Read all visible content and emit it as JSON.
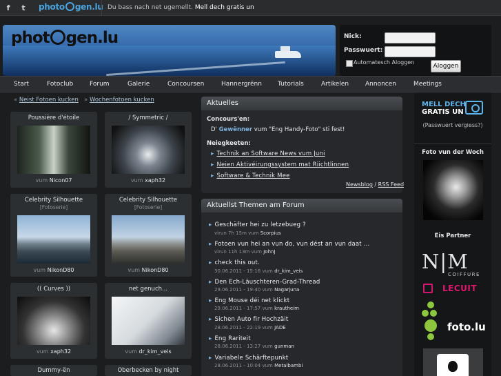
{
  "topbar": {
    "logo": "photogen.lu",
    "message_prefix": "Du bass nach net ugemellt.",
    "message_link": "Mell dech gratis un"
  },
  "header": {
    "logo": "photogen.lu"
  },
  "login": {
    "nick_label": "Nick:",
    "password_label": "Passwuert:",
    "auto_label": "Automatesch Aloggen",
    "button": "Aloggen"
  },
  "nav": [
    "Start",
    "Fotoclub",
    "Forum",
    "Galerie",
    "Concoursen",
    "Hannergrënn",
    "Tutorials",
    "Artikelen",
    "Annoncen",
    "Meetings"
  ],
  "crumbs": {
    "link1": "Neist Fotoen kucken",
    "link2": "Wochenfotoen kucken"
  },
  "thumbs": [
    {
      "title": "Poussière d'étoile",
      "sub": "",
      "by": "vum",
      "author": "Nicon07"
    },
    {
      "title": "/ Symmetric /",
      "sub": "",
      "by": "vum",
      "author": "xaph32"
    },
    {
      "title": "Celebrity Silhouette",
      "sub": "[Fotoserie]",
      "by": "vum",
      "author": "NikonD80"
    },
    {
      "title": "Celebrity Silhouette",
      "sub": "[Fotoserie]",
      "by": "vum",
      "author": "NikonD80"
    },
    {
      "title": "(( Curves ))",
      "sub": "",
      "by": "vum",
      "author": "xaph32"
    },
    {
      "title": "net genuch...",
      "sub": "",
      "by": "vum",
      "author": "dr_kim_veis"
    },
    {
      "title": "Dummy-ën",
      "sub": "",
      "by": "",
      "author": ""
    },
    {
      "title": "Oberbecken by night",
      "sub": "",
      "by": "",
      "author": ""
    }
  ],
  "aktuelles": {
    "heading": "Aktuelles",
    "concours_label": "Concours'en:",
    "concours_prefix": "D'",
    "concours_link": "Gewënner",
    "concours_mid": "vum",
    "concours_title": "\"Eng Handy-Foto\"",
    "concours_suffix": "sti fest!",
    "news_label": "Neiegkeeten:",
    "news": [
      "Technik an Software News vum Juni",
      "Neien Aktivéirungssystem mat Riichtlinnen",
      "Software & Technik Mee"
    ],
    "newsblog": "Newsblog",
    "rss": "RSS Feed"
  },
  "forum": {
    "heading": "Aktuellst Themen am Forum",
    "topics": [
      {
        "title": "Geschäfter hei zu letzebueg ?",
        "meta": "virun 7h 15m vum",
        "user": "Scorpius"
      },
      {
        "title": "Fotoen vun hei an vun do, vun dést an vun daat ...",
        "meta": "virun 11h 13m vum",
        "user": "JohnJ"
      },
      {
        "title": "check this out.",
        "meta": "30.06.2011 - 15:16 vum",
        "user": "dr_kim_veis"
      },
      {
        "title": "Den Ech-Läuschteren-Grad-Thread",
        "meta": "29.06.2011 - 19:40 vum",
        "user": "Nagarjuna"
      },
      {
        "title": "Eng Mouse déi net klickt",
        "meta": "29.06.2011 - 17:57 vum",
        "user": "krautheim"
      },
      {
        "title": "Sichen Auto fir Hochzäit",
        "meta": "28.06.2011 - 22:19 vum",
        "user": "JADE"
      },
      {
        "title": "Eng Rariteit",
        "meta": "28.06.2011 - 13:27 vum",
        "user": "gunman"
      },
      {
        "title": "Variabele Schärftepunkt",
        "meta": "28.06.2011 - 10:04 vum",
        "user": "Metalbambi"
      }
    ]
  },
  "right": {
    "signup_line1": "MELL DECH",
    "signup_line2": "GRATIS UN",
    "forgot": "(Passwuert vergiess?)",
    "photo_week": "Foto vun der Woch",
    "partner": "Eis Partner",
    "nm": "N|M",
    "coiffure": "COIFFURE",
    "lecuit": "LECUIT",
    "foto": "foto.lu"
  }
}
